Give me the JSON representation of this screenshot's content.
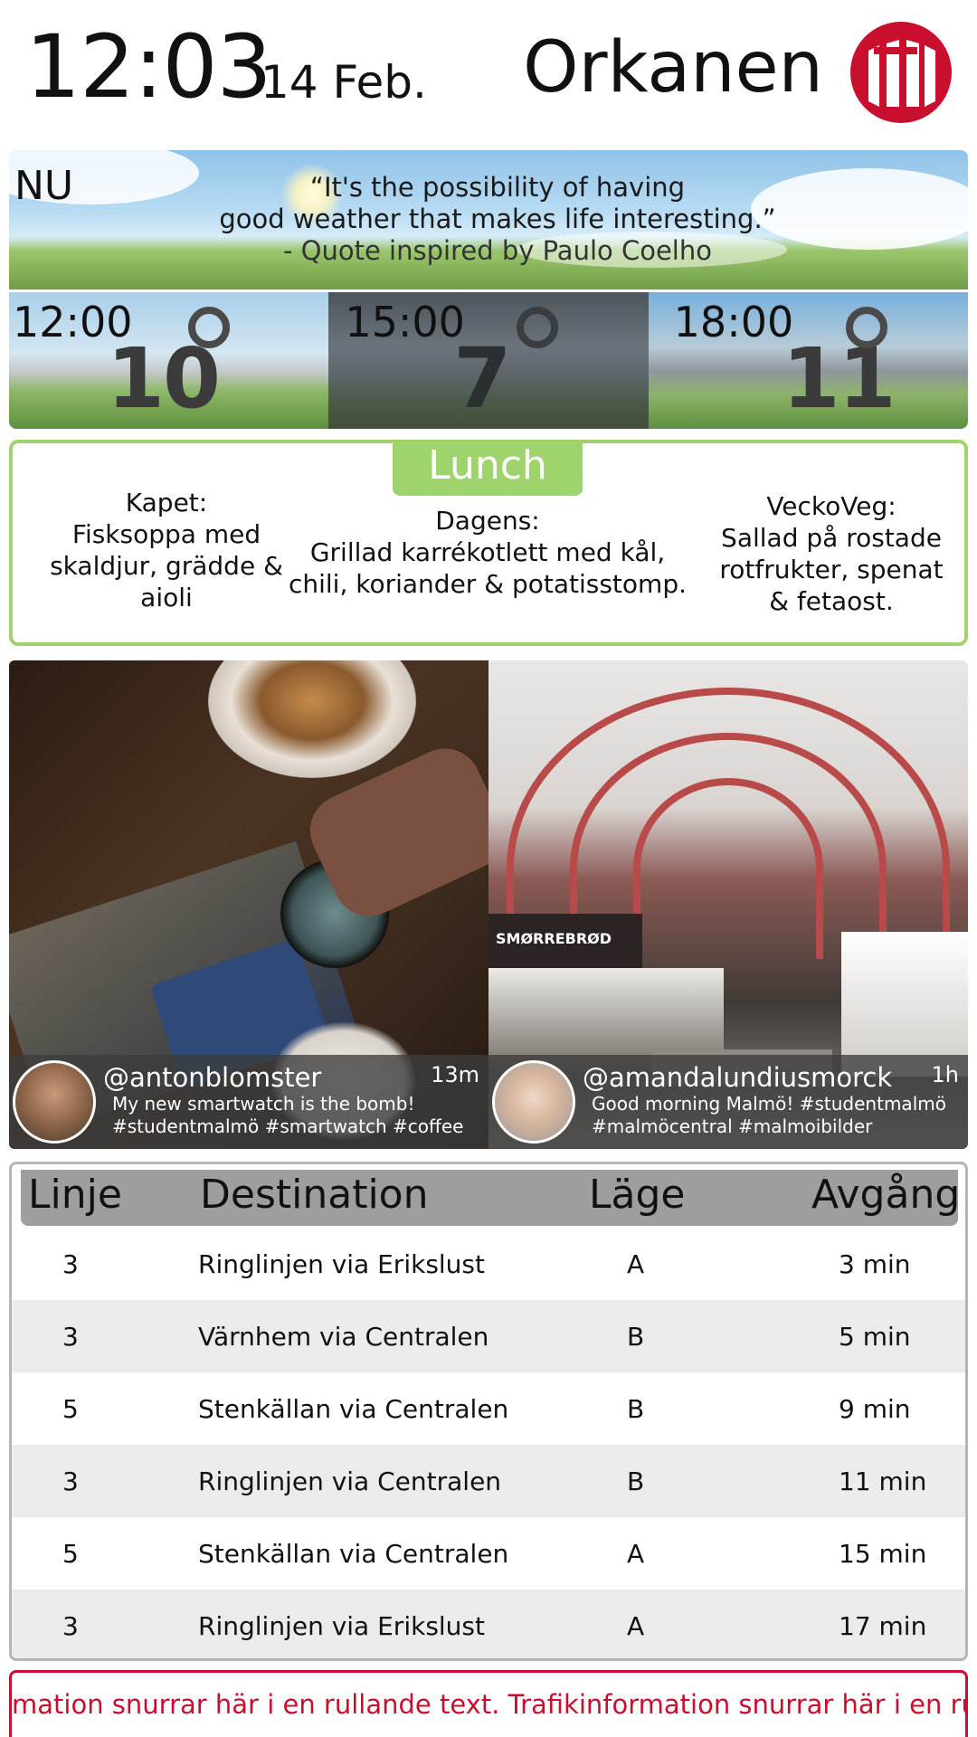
{
  "header": {
    "time": "12:03",
    "date": "14 Feb.",
    "location": "Orkanen",
    "logo_icon": "malmo-university-logo",
    "logo_color": "#c8102e"
  },
  "weather": {
    "now_label": "NU",
    "quote_line1": "“It's the possibility of having",
    "quote_line2": "good weather that makes life interesting.”",
    "quote_author": "- Quote inspired by Paulo Coelho",
    "forecast": [
      {
        "time": "12:00",
        "temp": "10",
        "condition": "partly-cloudy"
      },
      {
        "time": "15:00",
        "temp": "7",
        "condition": "rain"
      },
      {
        "time": "18:00",
        "temp": "11",
        "condition": "cloudy"
      }
    ]
  },
  "lunch": {
    "title": "Lunch",
    "accent": "#9fd36e",
    "items": [
      {
        "name": "Kapet:",
        "dish": "Fisksoppa med skaldjur, grädde & aioli"
      },
      {
        "name": "Dagens:",
        "dish": "Grillad karrékotlett med kål, chili, koriander & potatisstomp."
      },
      {
        "name": "VeckoVeg:",
        "dish": "Sallad på rostade rotfrukter, spenat & fetaost."
      }
    ]
  },
  "social": [
    {
      "handle": "@antonblomster",
      "age": "13m",
      "message_line1": "My new smartwatch is the bomb!",
      "message_line2": "#studentmalmö #smartwatch #coffee",
      "photo": "smartwatch-coffee-photo"
    },
    {
      "handle": "@amandalundiusmorck",
      "age": "1h",
      "message_line1": "Good morning Malmö! #studentmalmö",
      "message_line2": "#malmöcentral #malmoibilder",
      "photo": "malmo-central-station-photo"
    }
  ],
  "departures": {
    "headers": {
      "line": "Linje",
      "destination": "Destination",
      "position": "Läge",
      "departure": "Avgång"
    },
    "rows": [
      {
        "line": "3",
        "destination": "Ringlinjen via Erikslust",
        "position": "A",
        "departure": "3 min"
      },
      {
        "line": "3",
        "destination": "Värnhem via Centralen",
        "position": "B",
        "departure": "5 min"
      },
      {
        "line": "5",
        "destination": "Stenkällan via Centralen",
        "position": "B",
        "departure": "9 min"
      },
      {
        "line": "3",
        "destination": "Ringlinjen via Centralen",
        "position": "B",
        "departure": "11 min"
      },
      {
        "line": "5",
        "destination": "Stenkällan via Centralen",
        "position": "A",
        "departure": "15 min"
      },
      {
        "line": "3",
        "destination": "Ringlinjen via Erikslust",
        "position": "A",
        "departure": "17 min"
      }
    ]
  },
  "ticker": {
    "text": "mation snurrar här i en rullande text.  Trafikinformation snurrar här i en rullande",
    "color": "#c8102e"
  }
}
